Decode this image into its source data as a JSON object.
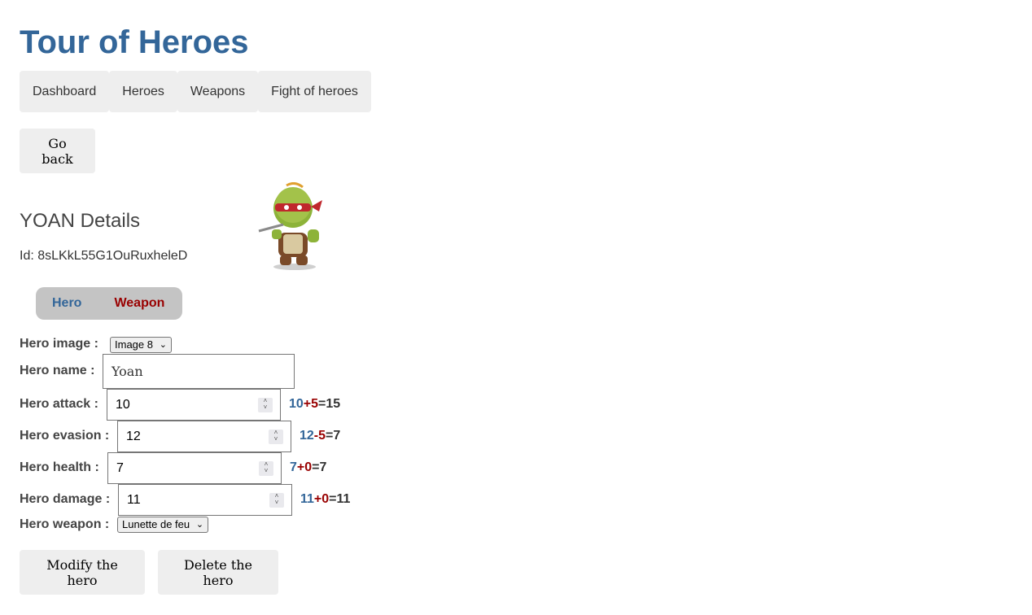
{
  "app": {
    "title": "Tour of Heroes"
  },
  "nav": {
    "items": [
      "Dashboard",
      "Heroes",
      "Weapons",
      "Fight of heroes"
    ]
  },
  "actions": {
    "go_back": "Go back",
    "modify": "Modify the hero",
    "delete": "Delete the hero"
  },
  "hero": {
    "details_title": "YOAN Details",
    "id_label": "Id: 8sLKkL55G1OuRuxheleD"
  },
  "tabs": {
    "hero": "Hero",
    "weapon": "Weapon"
  },
  "form": {
    "image_label": "Hero image :",
    "image_value": "Image 8",
    "name_label": "Hero name :",
    "name_value": "Yoan",
    "attack_label": "Hero attack :",
    "attack_value": "10",
    "evasion_label": "Hero evasion :",
    "evasion_value": "12",
    "health_label": "Hero health :",
    "health_value": "7",
    "damage_label": "Hero damage :",
    "damage_value": "11",
    "weapon_label": "Hero weapon :",
    "weapon_value": "Lunette de feu"
  },
  "stats": {
    "attack": {
      "base": "10",
      "mod": "+5",
      "eq": "=15"
    },
    "evasion": {
      "base": "12",
      "mod": "-5",
      "eq": "=7"
    },
    "health": {
      "base": "7",
      "mod": "+0",
      "eq": "=7"
    },
    "damage": {
      "base": "11",
      "mod": "+0",
      "eq": "=11"
    }
  },
  "colors": {
    "title": "#336699",
    "hero_tab": "#336699",
    "weapon_tab": "#990000"
  },
  "icons": {
    "avatar": "ninja-turtle-avatar",
    "chevron": "chevron-down-icon",
    "spinner": "spin-arrows-icon"
  }
}
